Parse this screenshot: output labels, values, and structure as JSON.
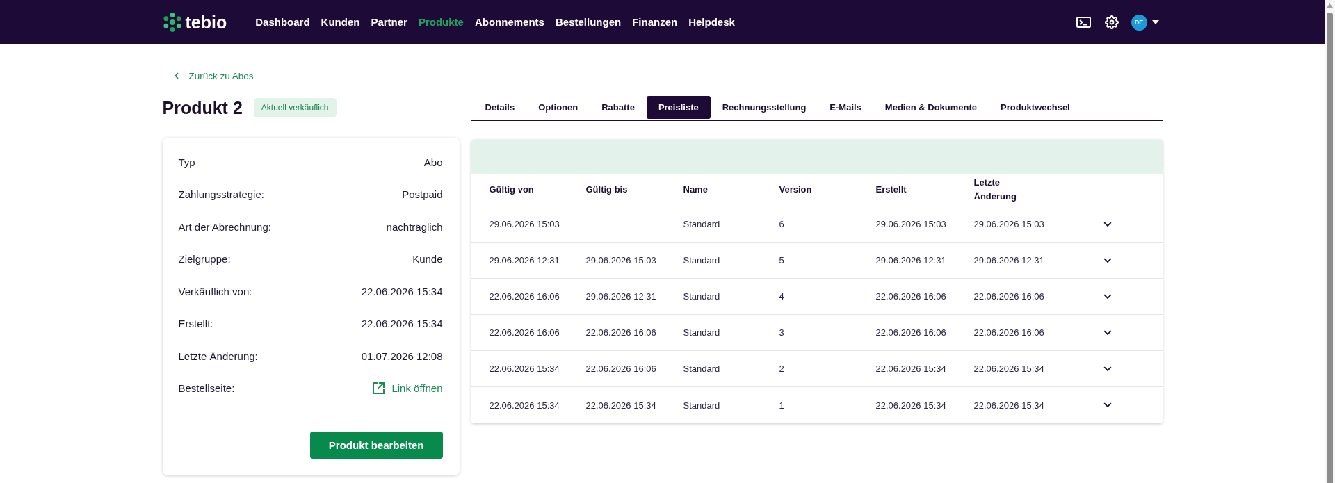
{
  "header": {
    "logo": "tebio",
    "nav": [
      {
        "label": "Dashboard",
        "selected": false
      },
      {
        "label": "Kunden",
        "selected": false
      },
      {
        "label": "Partner",
        "selected": false
      },
      {
        "label": "Produkte",
        "selected": true
      },
      {
        "label": "Abonnements",
        "selected": false
      },
      {
        "label": "Bestellungen",
        "selected": false
      },
      {
        "label": "Finanzen",
        "selected": false
      },
      {
        "label": "Helpdesk",
        "selected": false
      }
    ],
    "avatar": {
      "initials": "DE"
    }
  },
  "back_link": {
    "label": "Zurück zu Abos"
  },
  "product": {
    "title": "Produkt 2",
    "badge": "Aktuell verkäuflich"
  },
  "details": {
    "rows": [
      {
        "kind": "text",
        "label": "Typ",
        "value": "Abo"
      },
      {
        "kind": "text",
        "label": "Zahlungsstrategie:",
        "value": "Postpaid"
      },
      {
        "kind": "text",
        "label": "Art der Abrechnung:",
        "value": "nachträglich"
      },
      {
        "kind": "text",
        "label": "Zielgruppe:",
        "value": "Kunde"
      },
      {
        "kind": "text",
        "label": "Verkäuflich von:",
        "value": "22.06.2026 15:34"
      },
      {
        "kind": "text",
        "label": "Erstellt:",
        "value": "22.06.2026 15:34"
      },
      {
        "kind": "text",
        "label": "Letzte Änderung:",
        "value": "01.07.2026 12:08"
      },
      {
        "kind": "link",
        "label": "Bestellseite:",
        "value": "Link öffnen"
      }
    ],
    "edit_button": "Produkt bearbeiten"
  },
  "tabs": [
    {
      "label": "Details",
      "selected": false
    },
    {
      "label": "Optionen",
      "selected": false
    },
    {
      "label": "Rabatte",
      "selected": false
    },
    {
      "label": "Preisliste",
      "selected": true
    },
    {
      "label": "Rechnungsstellung",
      "selected": false
    },
    {
      "label": "E-Mails",
      "selected": false
    },
    {
      "label": "Medien & Dokumente",
      "selected": false
    },
    {
      "label": "Produktwechsel",
      "selected": false
    }
  ],
  "price_list": {
    "columns": [
      "Gültig von",
      "Gültig bis",
      "Name",
      "Version",
      "Erstellt",
      "Letzte Änderung"
    ],
    "rows": [
      {
        "valid_from": "29.06.2026 15:03",
        "name": "Standard",
        "version": "6",
        "created": "29.06.2026 15:03",
        "last_changed": "29.06.2026 15:03",
        "expanded": false
      },
      {
        "valid_from": "29.06.2026 12:31",
        "valid_to": "29.06.2026 15:03",
        "name": "Standard",
        "version": "5",
        "created": "29.06.2026 12:31",
        "last_changed": "29.06.2026 12:31",
        "expanded": false
      },
      {
        "valid_from": "22.06.2026 16:06",
        "valid_to": "29.06.2026 12:31",
        "name": "Standard",
        "version": "4",
        "created": "22.06.2026 16:06",
        "last_changed": "22.06.2026 16:06",
        "expanded": false
      },
      {
        "valid_from": "22.06.2026 16:06",
        "valid_to": "22.06.2026 16:06",
        "name": "Standard",
        "version": "3",
        "created": "22.06.2026 16:06",
        "last_changed": "22.06.2026 16:06",
        "expanded": false
      },
      {
        "valid_from": "22.06.2026 15:34",
        "valid_to": "22.06.2026 16:06",
        "name": "Standard",
        "version": "2",
        "created": "22.06.2026 15:34",
        "last_changed": "22.06.2026 15:34",
        "expanded": false
      },
      {
        "valid_from": "22.06.2026 15:34",
        "valid_to": "22.06.2026 15:34",
        "name": "Standard",
        "version": "1",
        "created": "22.06.2026 15:34",
        "last_changed": "22.06.2026 15:34",
        "expanded": false
      }
    ]
  }
}
